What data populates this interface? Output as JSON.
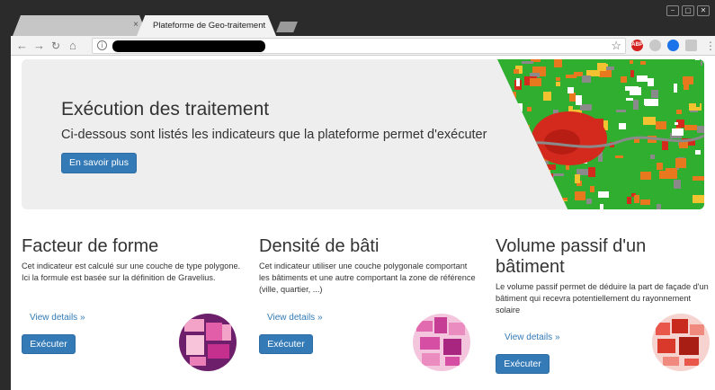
{
  "browser": {
    "inactive_tab_close": "×",
    "active_tab_title": "Plateforme de Geo-traitement",
    "active_tab_close": "×",
    "window_buttons": [
      "⎯",
      "▢",
      "✕"
    ],
    "extensions": {
      "abp": "ABP"
    }
  },
  "jumbotron": {
    "title": "Exécution des traitement",
    "lead": "Ci-dessous sont listés les indicateurs que la plateforme permet d'exécuter",
    "button": "En savoir plus"
  },
  "indicators": [
    {
      "title": "Facteur de forme",
      "description": "Cet indicateur est calculé sur une couche de type polygone. Ici la formule est basée sur la définition de Gravelius.",
      "link": "View details »",
      "button": "Exécuter"
    },
    {
      "title": "Densité de bâti",
      "description": "Cet indicateur utiliser une couche polygonale comportant les bâtiments et une autre comportant la zone de référence (ville, quartier, ...)",
      "link": "View details »",
      "button": "Exécuter"
    },
    {
      "title": "Volume passif d'un bâtiment",
      "description": "Le volume passif permet de déduire la part de façade d'un bâtiment qui recevra potentiellement du rayonnement solaire",
      "link": "View details »",
      "button": "Exécuter"
    }
  ],
  "colors": {
    "primary": "#337ab7",
    "jumbotron_bg": "#eeeeee",
    "map_orange": "#e8781e",
    "map_green": "#2fae2f",
    "map_red": "#d42a1e"
  }
}
